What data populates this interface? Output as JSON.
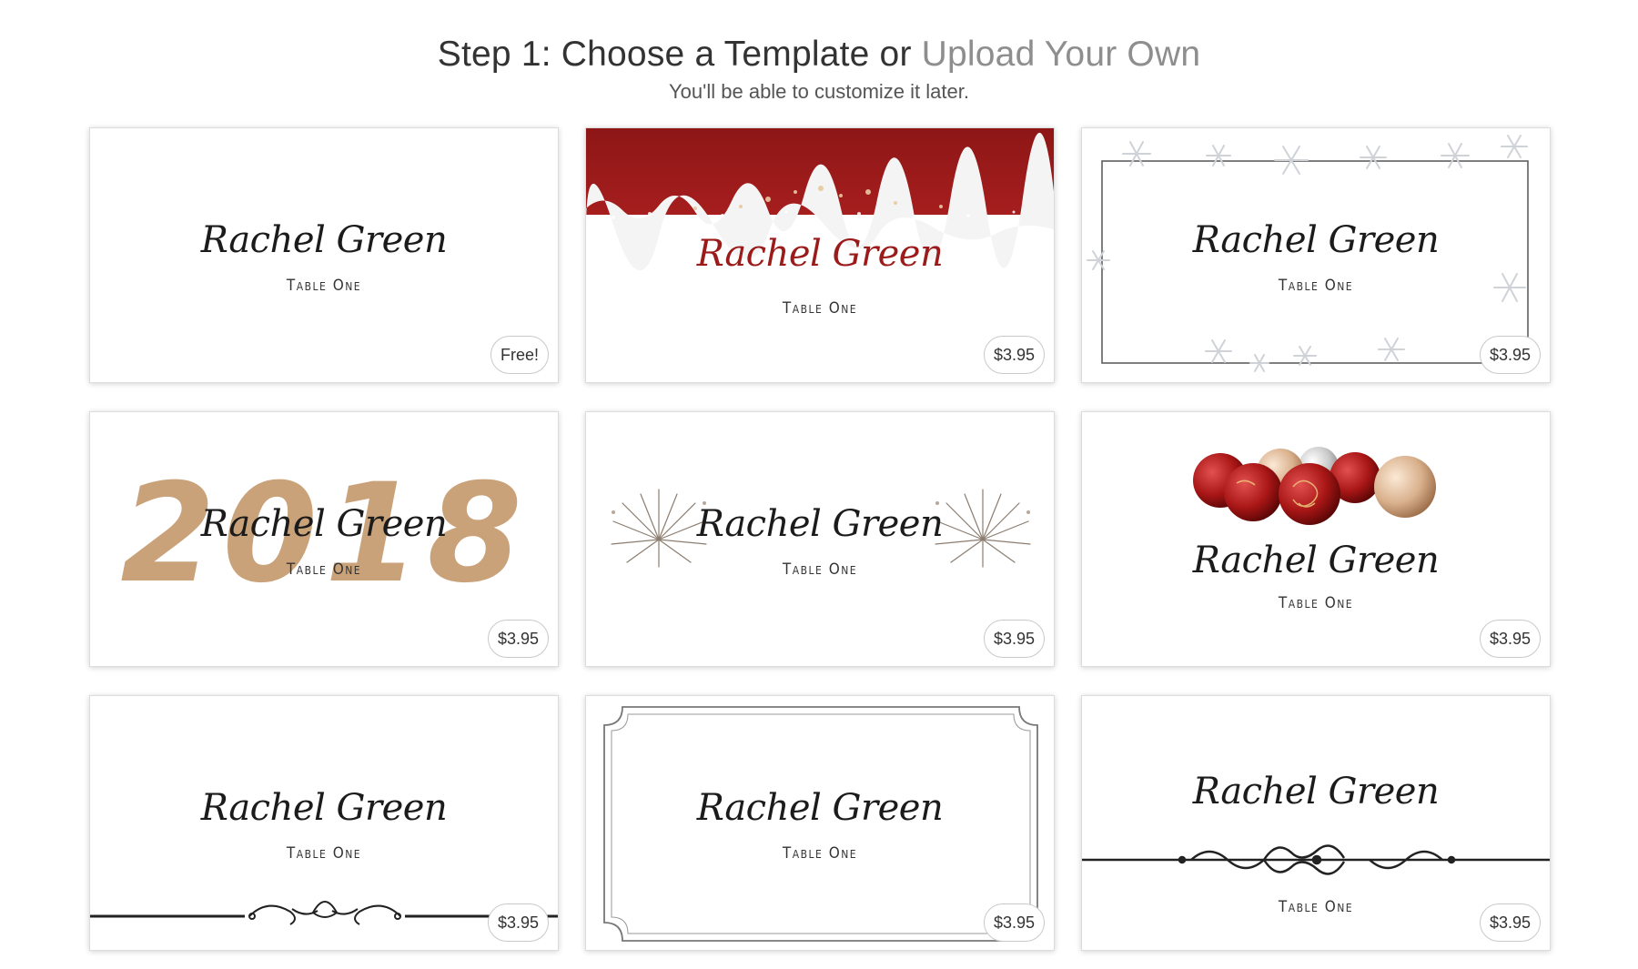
{
  "header": {
    "title_prefix": "Step 1: Choose a Template or ",
    "upload_link": "Upload Your Own",
    "subtitle": "You'll be able to customize it later."
  },
  "templates": [
    {
      "name": "Rachel Green",
      "table": "Table One",
      "price": "Free!",
      "design": "plain"
    },
    {
      "name": "Rachel Green",
      "table": "Table One",
      "price": "$3.95",
      "design": "red-snow-banner"
    },
    {
      "name": "Rachel Green",
      "table": "Table One",
      "price": "$3.95",
      "design": "snowflake-frame"
    },
    {
      "name": "Rachel Green",
      "table": "Table One",
      "price": "$3.95",
      "design": "gold-2018",
      "year": "2018"
    },
    {
      "name": "Rachel Green",
      "table": "Table One",
      "price": "$3.95",
      "design": "fireworks"
    },
    {
      "name": "Rachel Green",
      "table": "Table One",
      "price": "$3.95",
      "design": "ornaments"
    },
    {
      "name": "Rachel Green",
      "table": "Table One",
      "price": "$3.95",
      "design": "flourish-bottom"
    },
    {
      "name": "Rachel Green",
      "table": "Table One",
      "price": "$3.95",
      "design": "notched-border"
    },
    {
      "name": "Rachel Green",
      "table": "Table One",
      "price": "$3.95",
      "design": "flourish-middle"
    }
  ],
  "colors": {
    "accent_red": "#9b1b1b",
    "gold": "#c9a27a",
    "link_gray": "#8e8e8e"
  }
}
